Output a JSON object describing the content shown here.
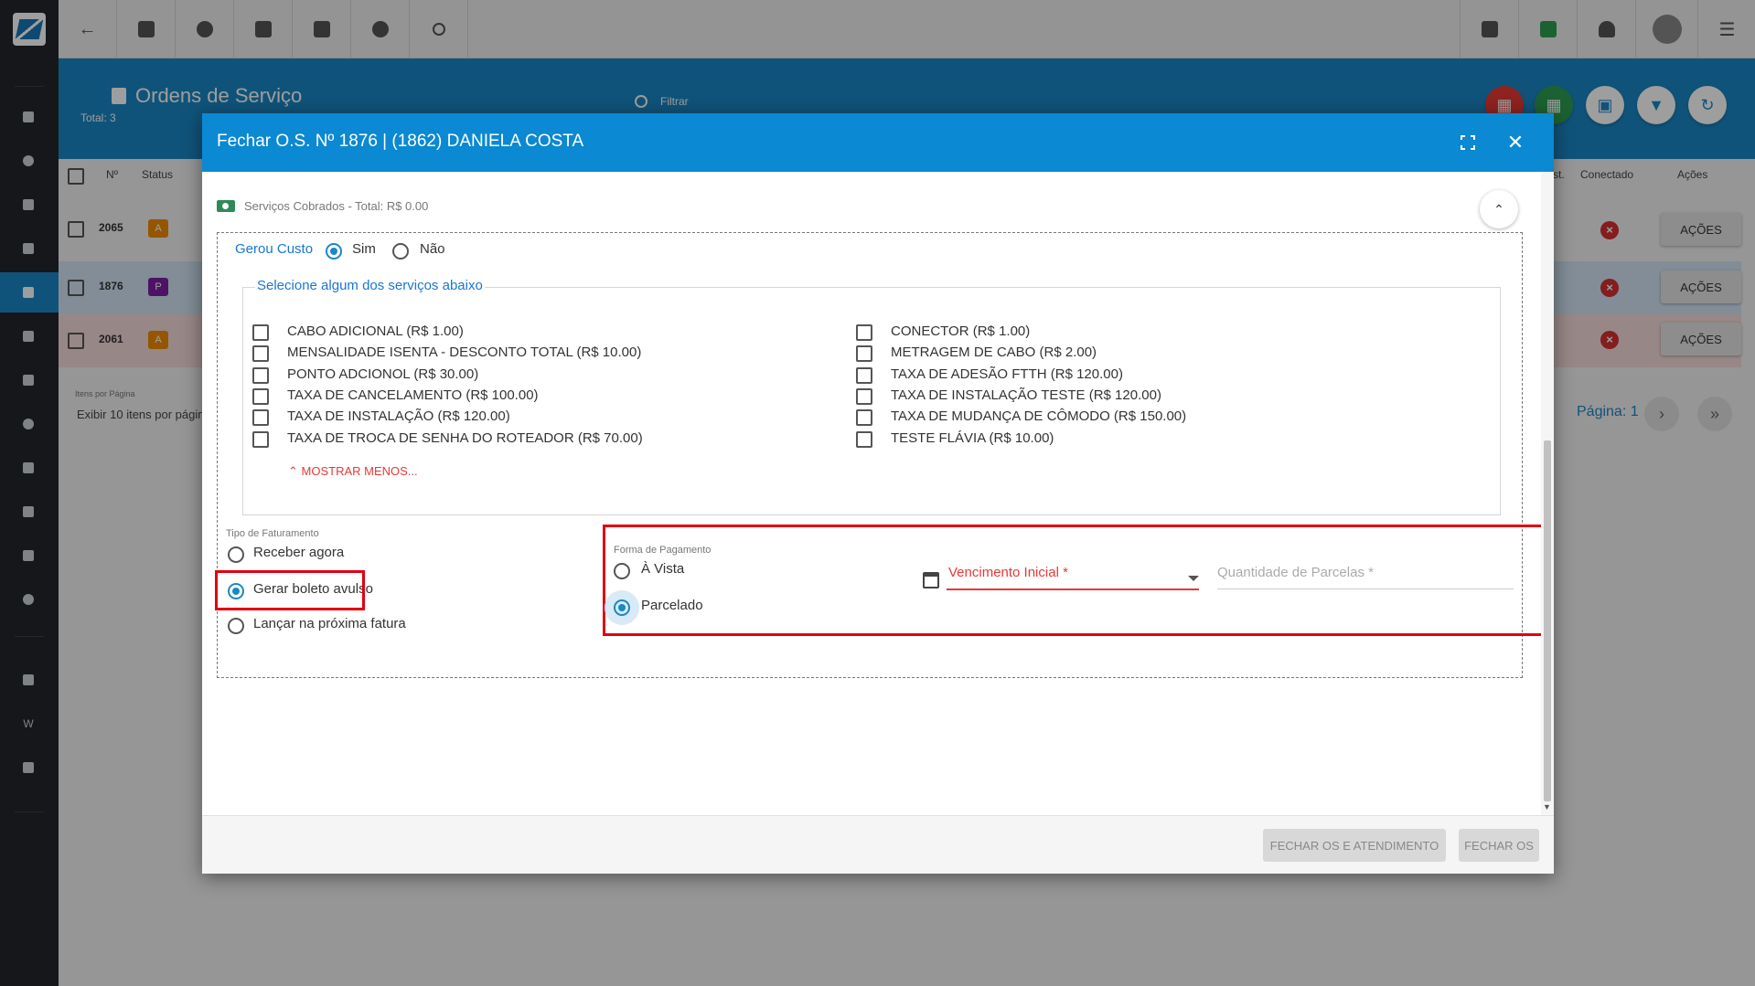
{
  "header": {
    "title": "Ordens de Serviço",
    "total": "Total: 3",
    "filter_placeholder": "Filtrar"
  },
  "table": {
    "headers": {
      "num": "Nº",
      "status": "Status",
      "est": "st.",
      "conectado": "Conectado",
      "acoes": "Ações"
    },
    "rows": [
      {
        "num": "2065",
        "badge": "A",
        "badge_color": "#f08c00",
        "bg": "#f2f2f2",
        "action": "AÇÕES"
      },
      {
        "num": "1876",
        "badge": "P",
        "badge_color": "#7b1fa2",
        "bg": "#d2e4f4",
        "action": "AÇÕES"
      },
      {
        "num": "2061",
        "badge": "A",
        "badge_color": "#f08c00",
        "bg": "#f6dada",
        "action": "AÇÕES"
      }
    ],
    "per_page_label": "Itens por Página",
    "per_page_value": "Exibir 10 itens por págin",
    "page": "Página: 1"
  },
  "modal": {
    "title": "Fechar O.S. Nº 1876 | (1862) DANIELA COSTA",
    "section_title": "Serviços Cobrados - Total: R$ 0.00",
    "gerou_custo": {
      "label": "Gerou Custo",
      "yes": "Sim",
      "no": "Não",
      "selected": "Sim"
    },
    "services_legend": "Selecione algum dos serviços abaixo",
    "services_left": [
      "CABO ADICIONAL (R$ 1.00)",
      "MENSALIDADE ISENTA - DESCONTO TOTAL (R$ 10.00)",
      "PONTO ADCIONOL (R$ 30.00)",
      "TAXA DE CANCELAMENTO (R$ 100.00)",
      "TAXA DE INSTALAÇÃO (R$ 120.00)",
      "TAXA DE TROCA DE SENHA DO ROTEADOR (R$ 70.00)"
    ],
    "services_right": [
      "CONECTOR (R$ 1.00)",
      "METRAGEM DE CABO (R$ 2.00)",
      "TAXA DE ADESÃO FTTH (R$ 120.00)",
      "TAXA DE INSTALAÇÃO TESTE (R$ 120.00)",
      "TAXA DE MUDANÇA DE CÔMODO (R$ 150.00)",
      "TESTE FLÁVIA (R$ 10.00)"
    ],
    "show_less": "MOSTRAR MENOS...",
    "billing": {
      "label": "Tipo de Faturamento",
      "options": [
        "Receber agora",
        "Gerar boleto avulso",
        "Lançar na próxima fatura"
      ],
      "selected": "Gerar boleto avulso"
    },
    "payment": {
      "label": "Forma de Pagamento",
      "options": [
        "À Vista",
        "Parcelado"
      ],
      "selected": "Parcelado",
      "due_date_label": "Vencimento Inicial *",
      "installments_label": "Quantidade de Parcelas *"
    },
    "footer": {
      "close_and_service": "FECHAR OS E ATENDIMENTO",
      "close": "FECHAR OS"
    }
  },
  "colors": {
    "primary": "#1b87c5",
    "modal_header": "#0b89d2",
    "highlight": "#e00010",
    "error": "#e53935"
  }
}
